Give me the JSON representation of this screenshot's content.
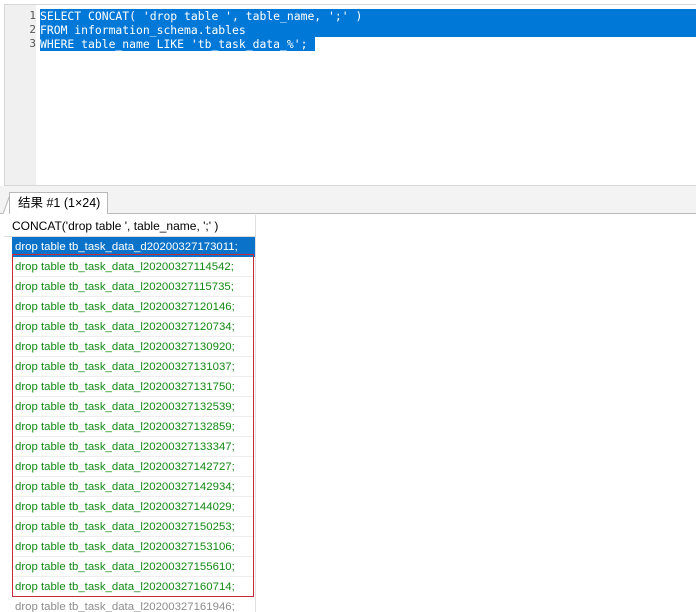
{
  "editor": {
    "line_numbers": [
      "1",
      "2",
      "3"
    ],
    "lines": [
      "SELECT CONCAT( 'drop table ', table_name, ';' )",
      "FROM information_schema.tables",
      "WHERE table_name LIKE 'tb_task_data_%';"
    ]
  },
  "results_tab": {
    "label": "结果 #1 (1×24)"
  },
  "result_grid": {
    "column_header": "CONCAT('drop table ', table_name, ';' )",
    "rows": [
      "drop table tb_task_data_d20200327173011;",
      "drop table tb_task_data_l20200327114542;",
      "drop table tb_task_data_l20200327115735;",
      "drop table tb_task_data_l20200327120146;",
      "drop table tb_task_data_l20200327120734;",
      "drop table tb_task_data_l20200327130920;",
      "drop table tb_task_data_l20200327131037;",
      "drop table tb_task_data_l20200327131750;",
      "drop table tb_task_data_l20200327132539;",
      "drop table tb_task_data_l20200327132859;",
      "drop table tb_task_data_l20200327133347;",
      "drop table tb_task_data_l20200327142727;",
      "drop table tb_task_data_l20200327142934;",
      "drop table tb_task_data_l20200327144029;",
      "drop table tb_task_data_l20200327150253;",
      "drop table tb_task_data_l20200327153106;",
      "drop table tb_task_data_l20200327155610;",
      "drop table tb_task_data_l20200327160714;",
      "drop table tb_task_data_l20200327161946;"
    ]
  },
  "colors": {
    "selection": "#0078d7",
    "row_text": "#128a12",
    "selected_row": "#0a73c9",
    "highlight_frame": "#c8283a"
  }
}
